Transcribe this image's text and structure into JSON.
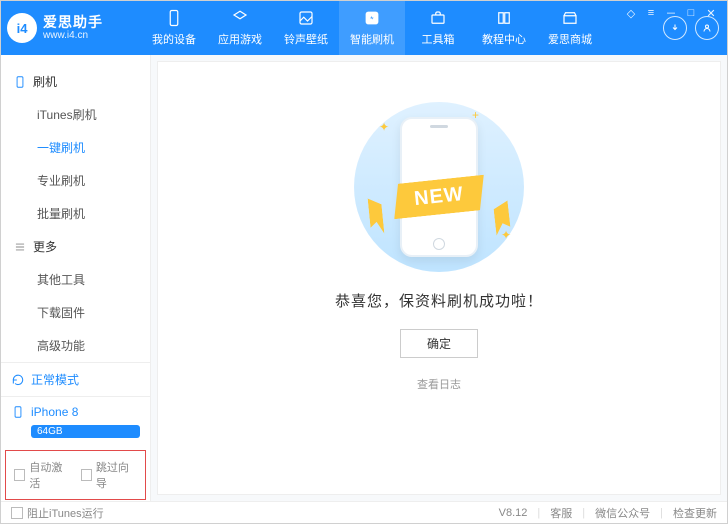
{
  "logo": {
    "badge": "i4",
    "brand": "爱思助手",
    "site": "www.i4.cn"
  },
  "nav": {
    "items": [
      {
        "label": "我的设备"
      },
      {
        "label": "应用游戏"
      },
      {
        "label": "铃声壁纸"
      },
      {
        "label": "智能刷机"
      },
      {
        "label": "工具箱"
      },
      {
        "label": "教程中心"
      },
      {
        "label": "爱思商城"
      }
    ],
    "active_index": 3
  },
  "sidebar": {
    "group_flash": "刷机",
    "group_more": "更多",
    "items_flash": [
      "iTunes刷机",
      "一键刷机",
      "专业刷机",
      "批量刷机"
    ],
    "active_flash_index": 1,
    "items_more": [
      "其他工具",
      "下载固件",
      "高级功能"
    ],
    "mode_label": "正常模式",
    "device_name": "iPhone 8",
    "device_storage": "64GB",
    "check_auto_activate": "自动激活",
    "check_skip_guide": "跳过向导"
  },
  "main": {
    "ribbon": "NEW",
    "success": "恭喜您，保资料刷机成功啦！",
    "ok": "确定",
    "log": "查看日志"
  },
  "footer": {
    "block_itunes": "阻止iTunes运行",
    "version": "V8.12",
    "links": [
      "客服",
      "微信公众号",
      "检查更新"
    ]
  }
}
